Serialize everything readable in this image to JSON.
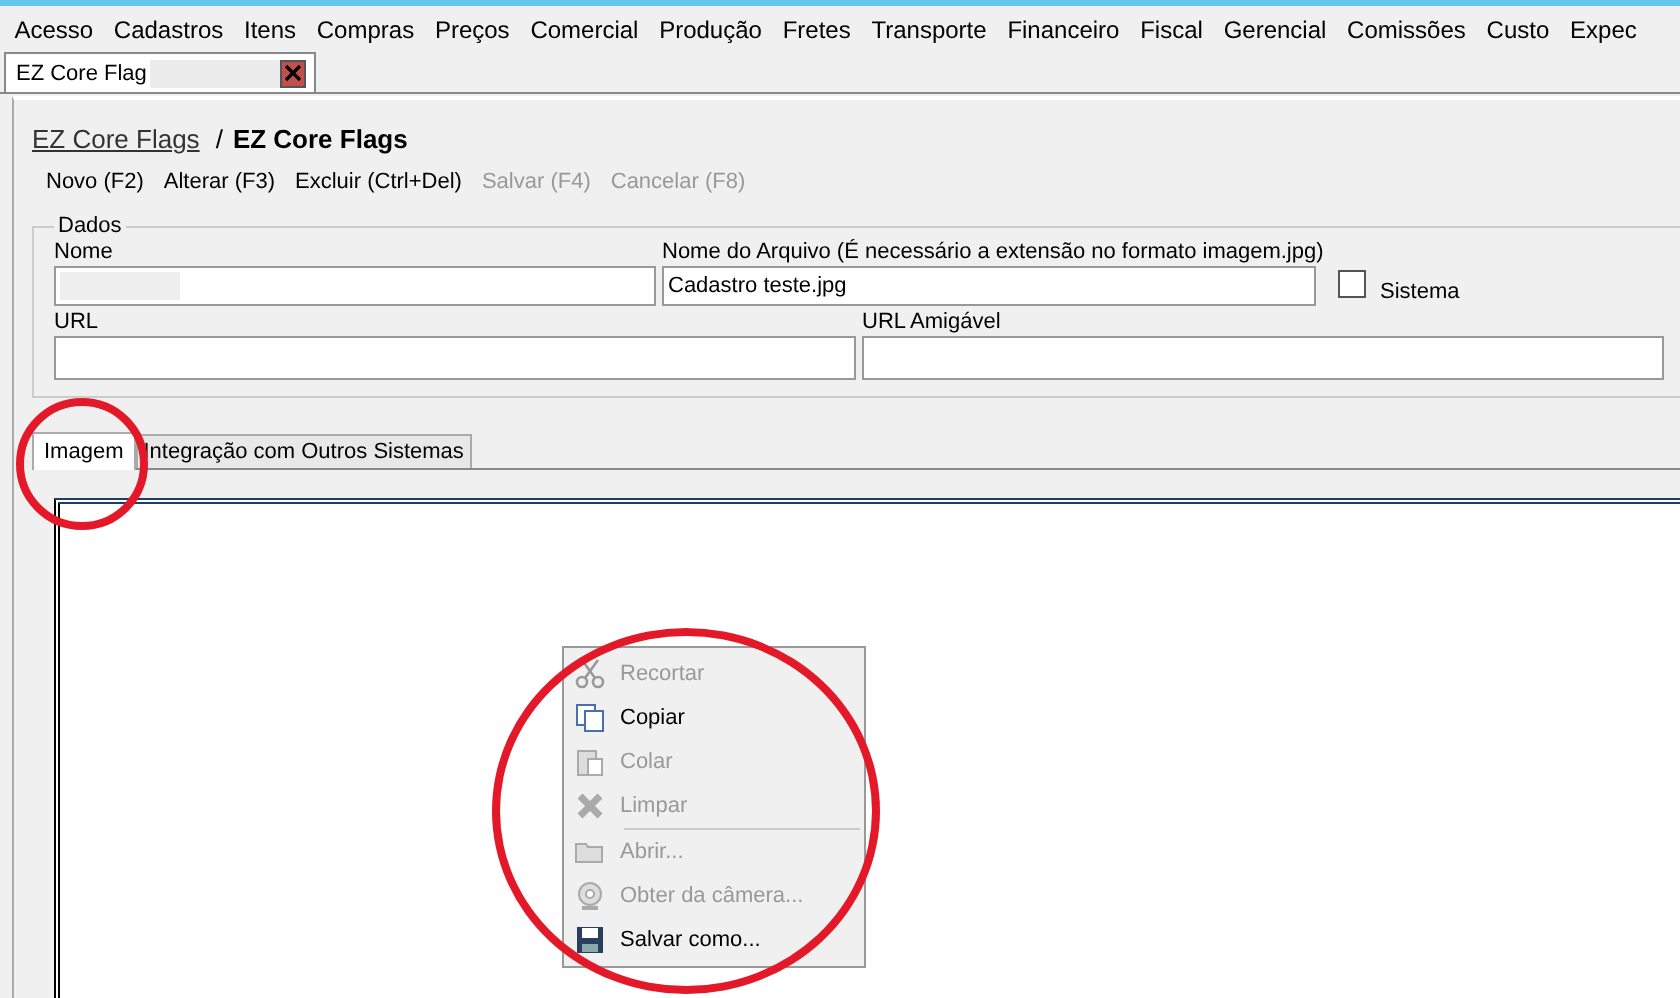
{
  "menu_bar": [
    "Acesso",
    "Cadastros",
    "Itens",
    "Compras",
    "Preços",
    "Comercial",
    "Produção",
    "Fretes",
    "Transporte",
    "Financeiro",
    "Fiscal",
    "Gerencial",
    "Comissões",
    "Custo",
    "Expec"
  ],
  "document_tab": {
    "title": "EZ Core Flag",
    "selected": true
  },
  "breadcrumb": {
    "link": "EZ Core Flags",
    "separator": "/",
    "current": "EZ Core Flags"
  },
  "toolbar": [
    {
      "label": "Novo (F2)",
      "disabled": false
    },
    {
      "label": "Alterar (F3)",
      "disabled": false
    },
    {
      "label": "Excluir (Ctrl+Del)",
      "disabled": false
    },
    {
      "label": "Salvar (F4)",
      "disabled": true
    },
    {
      "label": "Cancelar (F8)",
      "disabled": true
    }
  ],
  "group": {
    "title": "Dados",
    "nome": {
      "label": "Nome"
    },
    "arquivo": {
      "label": "Nome do Arquivo (É necessário a extensão no formato imagem.jpg)",
      "value": "Cadastro teste.jpg"
    },
    "sistema": {
      "label": "Sistema",
      "checked": false
    },
    "url": {
      "label": "URL"
    },
    "url_amigavel": {
      "label": "URL Amigável"
    }
  },
  "tabs": [
    {
      "label": "Imagem",
      "selected": true
    },
    {
      "label": "Integração com Outros Sistemas",
      "selected": false
    }
  ],
  "context_menu": [
    {
      "kind": "item",
      "label": "Recortar",
      "disabled": true
    },
    {
      "kind": "item",
      "label": "Copiar",
      "disabled": false
    },
    {
      "kind": "item",
      "label": "Colar",
      "disabled": true
    },
    {
      "kind": "item",
      "label": "Limpar",
      "disabled": true
    },
    {
      "kind": "separator"
    },
    {
      "kind": "item",
      "label": "Abrir...",
      "disabled": true
    },
    {
      "kind": "item",
      "label": "Obter da câmera...",
      "disabled": true
    },
    {
      "kind": "item",
      "label": "Salvar como...",
      "disabled": false
    }
  ]
}
